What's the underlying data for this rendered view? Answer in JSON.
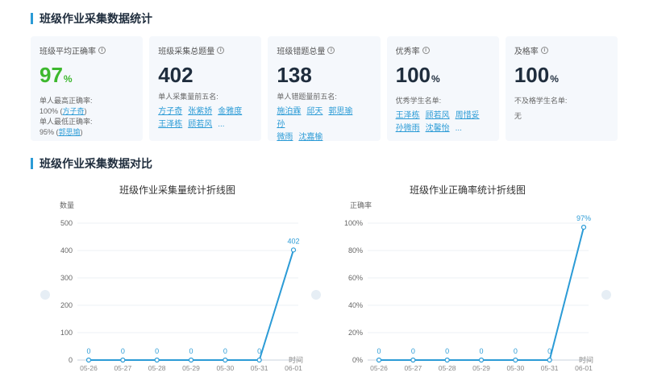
{
  "stats_title": "班级作业采集数据统计",
  "compare_title": "班级作业采集数据对比",
  "cards": [
    {
      "label": "班级平均正确率",
      "value": "97",
      "unit": "%",
      "lines": [
        {
          "text": "单人最高正确率:"
        },
        {
          "text": "100%",
          "name": "方子奇"
        },
        {
          "text": "单人最低正确率:"
        },
        {
          "text": "95%",
          "name": "郭思瑜"
        }
      ]
    },
    {
      "label": "班级采集总题量",
      "value": "402",
      "unit": "",
      "sub": "单人采集量前五名:",
      "names": [
        "方子奇",
        "张紫娇",
        "金雅度",
        "王泽栋",
        "顾若风"
      ],
      "more": "..."
    },
    {
      "label": "班级错题总量",
      "value": "138",
      "unit": "",
      "sub": "单人错题量前五名:",
      "names": [
        "施泊霖",
        "邱天",
        "郭思瑜",
        "孙",
        "微雨",
        "沈嘉榆"
      ],
      "more": ""
    },
    {
      "label": "优秀率",
      "value": "100",
      "unit": "%",
      "sub": "优秀学生名单:",
      "names": [
        "王泽栋",
        "顾若风",
        "周惜妥",
        "孙微雨",
        "沈馨怡"
      ],
      "more": "..."
    },
    {
      "label": "及格率",
      "value": "100",
      "unit": "%",
      "sub": "不及格学生名单:",
      "plain": "无"
    }
  ],
  "chart_data": [
    {
      "type": "line",
      "title": "班级作业采集量统计折线图",
      "ylabel": "数量",
      "xlabel": "时间",
      "categories": [
        "05-26",
        "05-27",
        "05-28",
        "05-29",
        "05-30",
        "05-31",
        "06-01"
      ],
      "values": [
        0,
        0,
        0,
        0,
        0,
        0,
        402
      ],
      "data_labels": [
        "0",
        "0",
        "0",
        "0",
        "0",
        "0",
        "402"
      ],
      "yticks": [
        "0",
        "100",
        "200",
        "300",
        "400",
        "500"
      ],
      "ylim": [
        0,
        500
      ],
      "color": "#2b9bd6",
      "grid": true
    },
    {
      "type": "line",
      "title": "班级作业正确率统计折线图",
      "ylabel": "正确率",
      "xlabel": "时间",
      "categories": [
        "05-26",
        "05-27",
        "05-28",
        "05-29",
        "05-30",
        "05-31",
        "06-01"
      ],
      "values": [
        0,
        0,
        0,
        0,
        0,
        0,
        97
      ],
      "data_labels": [
        "0",
        "0",
        "0",
        "0",
        "0",
        "0",
        "97%"
      ],
      "yticks": [
        "0%",
        "20%",
        "40%",
        "60%",
        "80%",
        "100%"
      ],
      "ylim": [
        0,
        100
      ],
      "color": "#2b9bd6",
      "grid": true
    }
  ]
}
